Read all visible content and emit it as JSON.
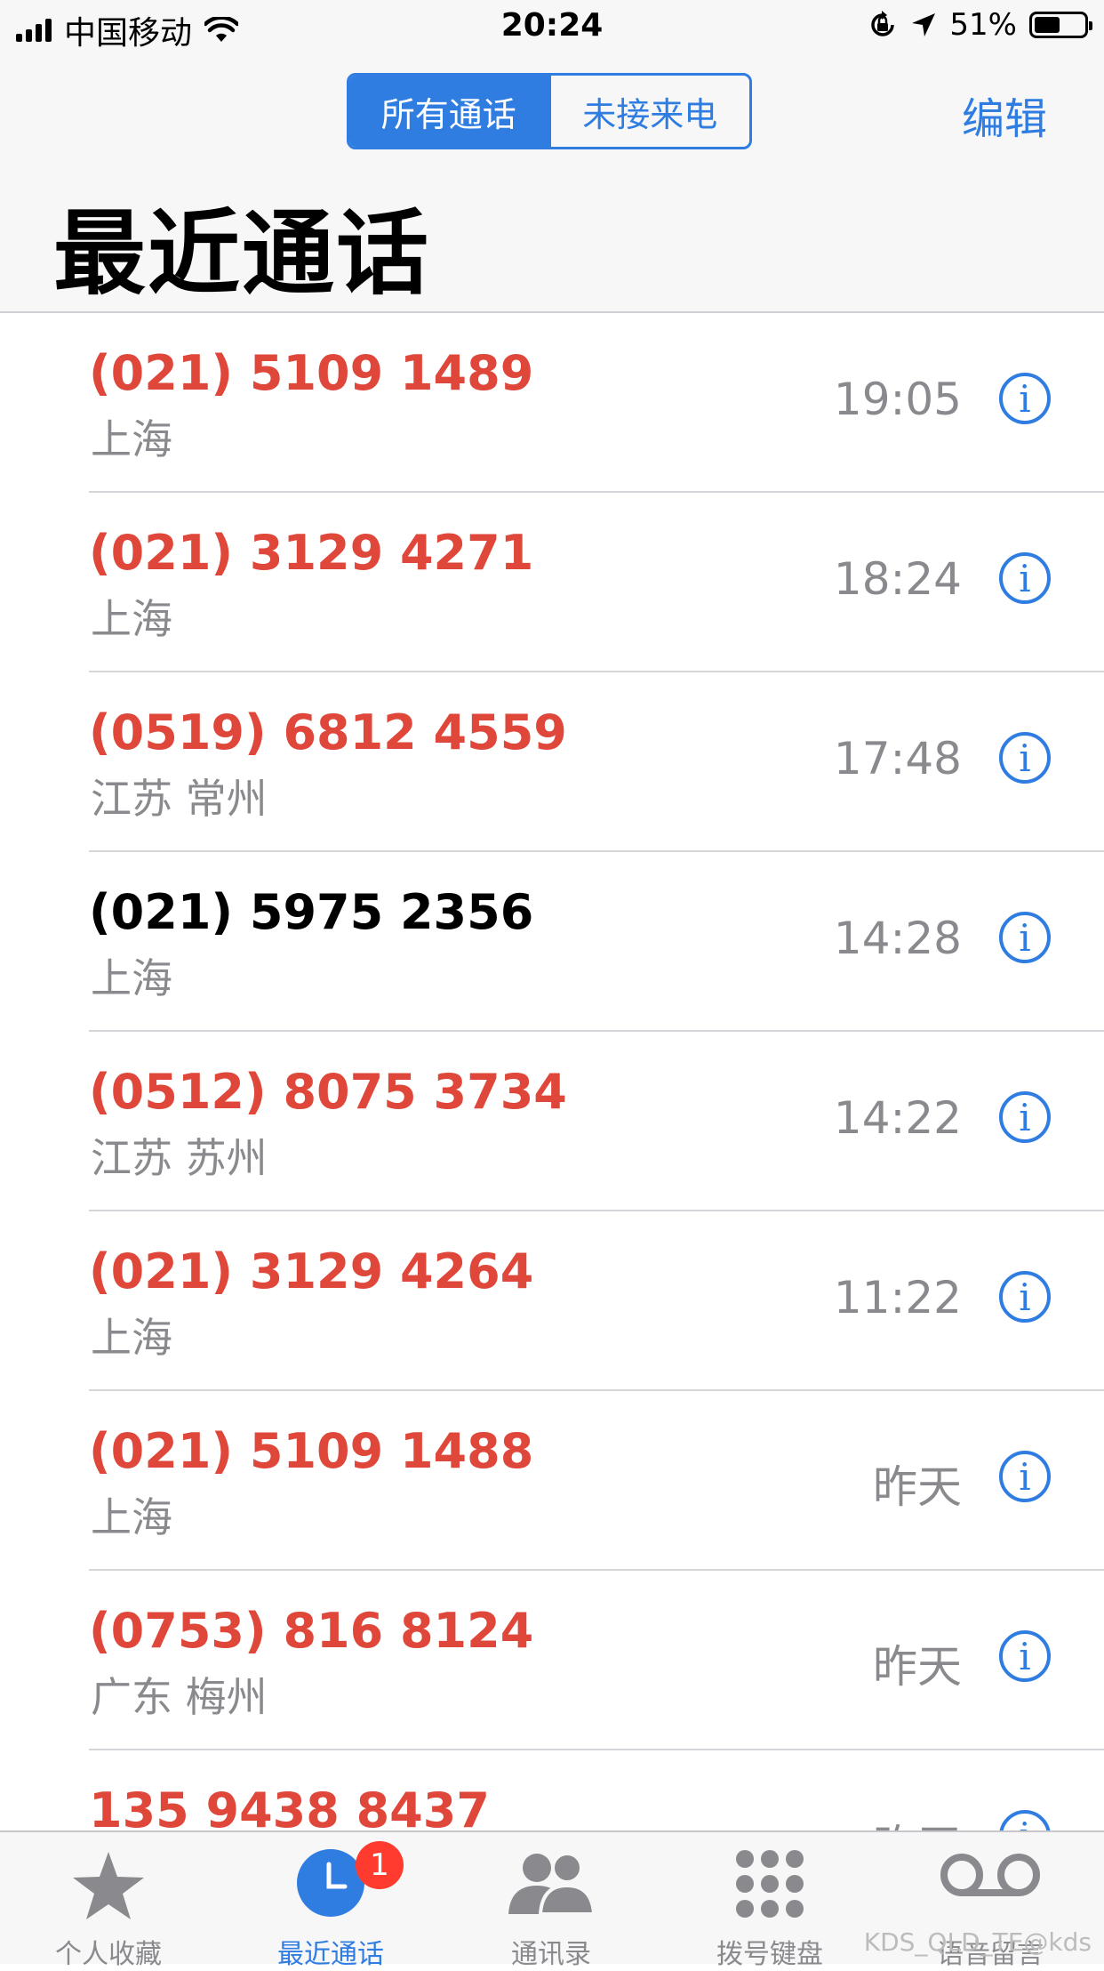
{
  "status_bar": {
    "carrier": "中国移动",
    "time": "20:24",
    "battery_percent": "51%",
    "battery_level": 0.51,
    "signal_icon": "signal-bars-icon",
    "wifi_icon": "wifi-icon",
    "rotation_lock_icon": "rotation-lock-icon",
    "location_icon": "location-arrow-icon"
  },
  "nav": {
    "segments": [
      "所有通话",
      "未接来电"
    ],
    "selected_segment": 0,
    "edit_label": "编辑",
    "title": "最近通话"
  },
  "calls": [
    {
      "number": "(021) 5109 1489",
      "location": "上海",
      "time": "19:05",
      "missed": true
    },
    {
      "number": "(021) 3129 4271",
      "location": "上海",
      "time": "18:24",
      "missed": true
    },
    {
      "number": "(0519) 6812 4559",
      "location": "江苏 常州",
      "time": "17:48",
      "missed": true
    },
    {
      "number": "(021) 5975 2356",
      "location": "上海",
      "time": "14:28",
      "missed": false
    },
    {
      "number": "(0512) 8075 3734",
      "location": "江苏 苏州",
      "time": "14:22",
      "missed": true
    },
    {
      "number": "(021) 3129 4264",
      "location": "上海",
      "time": "11:22",
      "missed": true
    },
    {
      "number": "(021) 5109 1488",
      "location": "上海",
      "time": "昨天",
      "missed": true
    },
    {
      "number": "(0753) 816 8124",
      "location": "广东 梅州",
      "time": "昨天",
      "missed": true
    },
    {
      "number": "135 9438 8437",
      "location": "",
      "time": "昨天",
      "missed": true
    }
  ],
  "info_glyph": "i",
  "colors": {
    "accent": "#2f7de1",
    "missed": "#e0473b",
    "secondary_text": "#8a8a8e",
    "badge": "#ff3b30"
  },
  "tabs": [
    {
      "label": "个人收藏",
      "icon": "star-icon"
    },
    {
      "label": "最近通话",
      "icon": "clock-icon",
      "badge": "1",
      "active": true
    },
    {
      "label": "通讯录",
      "icon": "contacts-icon"
    },
    {
      "label": "拨号键盘",
      "icon": "keypad-icon"
    },
    {
      "label": "语音留言",
      "icon": "voicemail-icon"
    }
  ],
  "watermark": "KDS_QLD_TE@kds"
}
